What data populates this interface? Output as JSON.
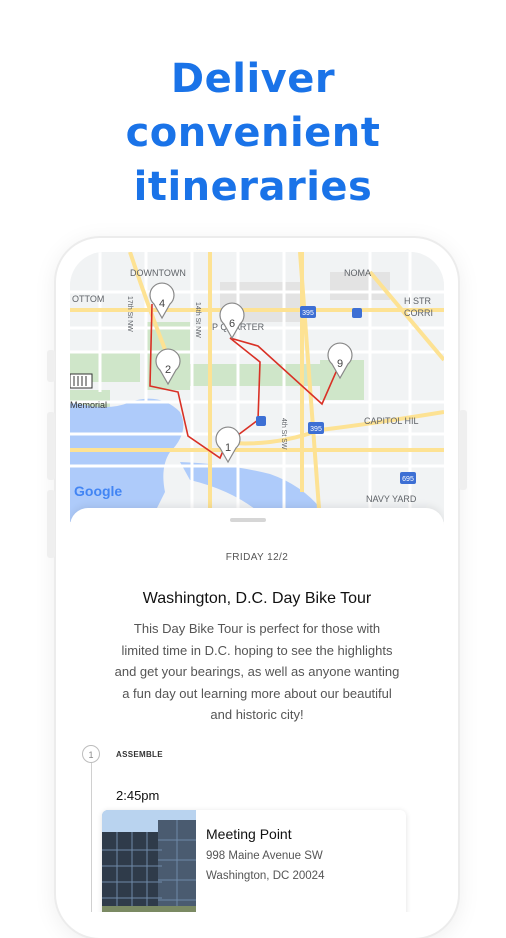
{
  "headline": {
    "line1": "Deliver",
    "line2": "convenient",
    "line3": "itineraries"
  },
  "colors": {
    "accent": "#1a73e8",
    "route": "#d93025",
    "park": "#cfe6c9",
    "water": "#aecbfa",
    "road": "#fde293"
  },
  "map": {
    "labels": {
      "downtown": "DOWNTOWN",
      "noma": "NOMA",
      "bottom": "OTTOM",
      "penn_quarter": "P   QUARTER",
      "h_street": "H STR",
      "corridor": "CORRI",
      "memorial": "Memorial",
      "capitol_hill": "CAPITOL HIL",
      "navy_yard": "NAVY YARD",
      "st_14": "14th St NW",
      "st_17": "17th St NW",
      "st_4": "4th St SW",
      "google": "Google"
    },
    "highway_shields": [
      "395",
      "395",
      "695"
    ],
    "pins": [
      "4",
      "6",
      "2",
      "9",
      "1"
    ]
  },
  "itinerary": {
    "date": "FRIDAY 12/2",
    "title": "Washington, D.C. Day Bike Tour",
    "description_lines": [
      "This Day Bike Tour is perfect for those with",
      "limited time in D.C. hoping to see the highlights",
      "and get your bearings, as well as anyone wanting",
      "a fun day out learning more about our beautiful",
      "and historic city!"
    ],
    "stop": {
      "number": "1",
      "label": "ASSEMBLE",
      "time": "2:45pm",
      "name": "Meeting Point",
      "address_line1": "998 Maine Avenue SW",
      "address_line2": "Washington, DC 20024"
    }
  }
}
